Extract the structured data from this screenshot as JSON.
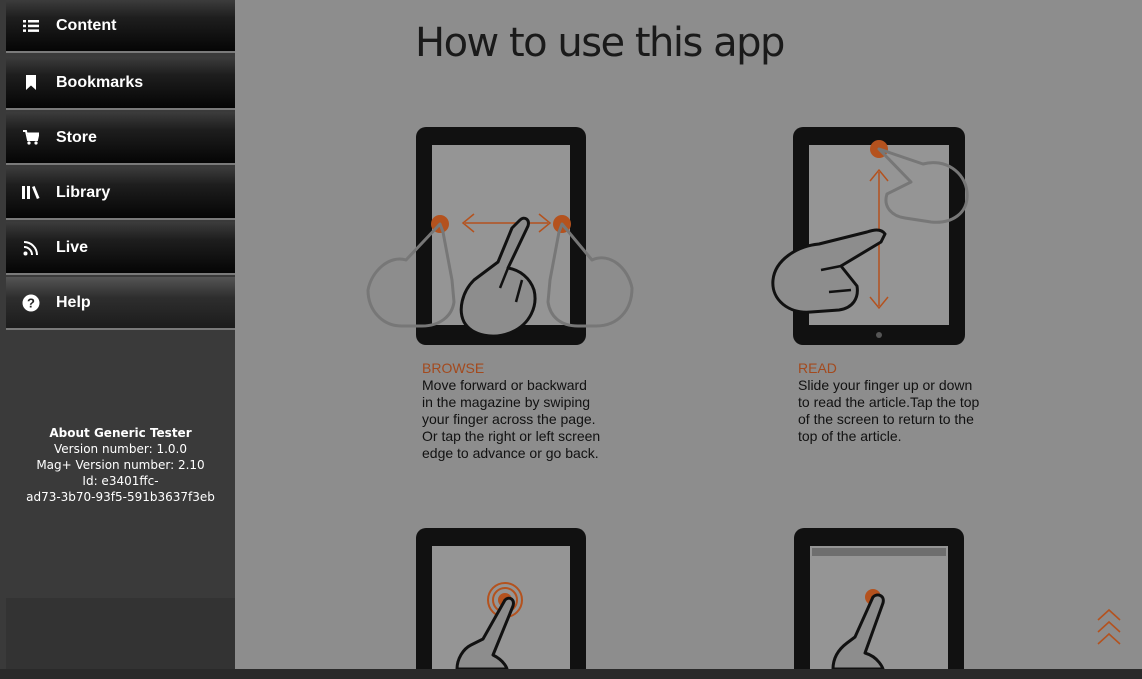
{
  "nav": {
    "items": [
      {
        "label": "Content",
        "icon": "list-icon"
      },
      {
        "label": "Bookmarks",
        "icon": "bookmark-icon"
      },
      {
        "label": "Store",
        "icon": "cart-icon"
      },
      {
        "label": "Library",
        "icon": "library-icon"
      },
      {
        "label": "Live",
        "icon": "rss-icon"
      },
      {
        "label": "Help",
        "icon": "help-icon"
      }
    ]
  },
  "about": {
    "title": "About Generic Tester",
    "version": "Version number: 1.0.0",
    "magplus_version": "Mag+ Version number: 2.10",
    "id_line1": "Id: e3401ffc-",
    "id_line2": "ad73-3b70-93f5-591b3637f3eb"
  },
  "help": {
    "title": "How to use this app",
    "browse": {
      "heading": "BROWSE",
      "lines": [
        "Move forward or backward",
        "in the magazine by swiping",
        "your finger across the page.",
        "Or tap the right or left screen",
        "edge to advance or go back."
      ]
    },
    "read": {
      "heading": "READ",
      "lines": [
        "Slide your finger up or down",
        "to read the article.Tap the top",
        "of the screen to return to the",
        "top of the article."
      ]
    }
  },
  "colors": {
    "accent": "#b4521e",
    "sidebar": "#3a3a3a",
    "page": "#8d8d8d"
  }
}
